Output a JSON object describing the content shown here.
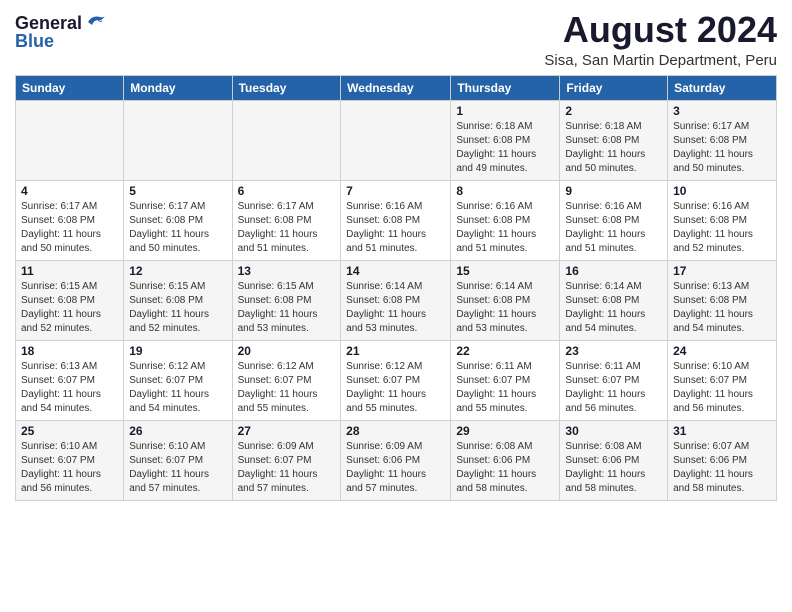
{
  "logo": {
    "general": "General",
    "blue": "Blue"
  },
  "header": {
    "month_year": "August 2024",
    "location": "Sisa, San Martin Department, Peru"
  },
  "weekdays": [
    "Sunday",
    "Monday",
    "Tuesday",
    "Wednesday",
    "Thursday",
    "Friday",
    "Saturday"
  ],
  "weeks": [
    [
      {
        "day": "",
        "info": ""
      },
      {
        "day": "",
        "info": ""
      },
      {
        "day": "",
        "info": ""
      },
      {
        "day": "",
        "info": ""
      },
      {
        "day": "1",
        "info": "Sunrise: 6:18 AM\nSunset: 6:08 PM\nDaylight: 11 hours\nand 49 minutes."
      },
      {
        "day": "2",
        "info": "Sunrise: 6:18 AM\nSunset: 6:08 PM\nDaylight: 11 hours\nand 50 minutes."
      },
      {
        "day": "3",
        "info": "Sunrise: 6:17 AM\nSunset: 6:08 PM\nDaylight: 11 hours\nand 50 minutes."
      }
    ],
    [
      {
        "day": "4",
        "info": "Sunrise: 6:17 AM\nSunset: 6:08 PM\nDaylight: 11 hours\nand 50 minutes."
      },
      {
        "day": "5",
        "info": "Sunrise: 6:17 AM\nSunset: 6:08 PM\nDaylight: 11 hours\nand 50 minutes."
      },
      {
        "day": "6",
        "info": "Sunrise: 6:17 AM\nSunset: 6:08 PM\nDaylight: 11 hours\nand 51 minutes."
      },
      {
        "day": "7",
        "info": "Sunrise: 6:16 AM\nSunset: 6:08 PM\nDaylight: 11 hours\nand 51 minutes."
      },
      {
        "day": "8",
        "info": "Sunrise: 6:16 AM\nSunset: 6:08 PM\nDaylight: 11 hours\nand 51 minutes."
      },
      {
        "day": "9",
        "info": "Sunrise: 6:16 AM\nSunset: 6:08 PM\nDaylight: 11 hours\nand 51 minutes."
      },
      {
        "day": "10",
        "info": "Sunrise: 6:16 AM\nSunset: 6:08 PM\nDaylight: 11 hours\nand 52 minutes."
      }
    ],
    [
      {
        "day": "11",
        "info": "Sunrise: 6:15 AM\nSunset: 6:08 PM\nDaylight: 11 hours\nand 52 minutes."
      },
      {
        "day": "12",
        "info": "Sunrise: 6:15 AM\nSunset: 6:08 PM\nDaylight: 11 hours\nand 52 minutes."
      },
      {
        "day": "13",
        "info": "Sunrise: 6:15 AM\nSunset: 6:08 PM\nDaylight: 11 hours\nand 53 minutes."
      },
      {
        "day": "14",
        "info": "Sunrise: 6:14 AM\nSunset: 6:08 PM\nDaylight: 11 hours\nand 53 minutes."
      },
      {
        "day": "15",
        "info": "Sunrise: 6:14 AM\nSunset: 6:08 PM\nDaylight: 11 hours\nand 53 minutes."
      },
      {
        "day": "16",
        "info": "Sunrise: 6:14 AM\nSunset: 6:08 PM\nDaylight: 11 hours\nand 54 minutes."
      },
      {
        "day": "17",
        "info": "Sunrise: 6:13 AM\nSunset: 6:08 PM\nDaylight: 11 hours\nand 54 minutes."
      }
    ],
    [
      {
        "day": "18",
        "info": "Sunrise: 6:13 AM\nSunset: 6:07 PM\nDaylight: 11 hours\nand 54 minutes."
      },
      {
        "day": "19",
        "info": "Sunrise: 6:12 AM\nSunset: 6:07 PM\nDaylight: 11 hours\nand 54 minutes."
      },
      {
        "day": "20",
        "info": "Sunrise: 6:12 AM\nSunset: 6:07 PM\nDaylight: 11 hours\nand 55 minutes."
      },
      {
        "day": "21",
        "info": "Sunrise: 6:12 AM\nSunset: 6:07 PM\nDaylight: 11 hours\nand 55 minutes."
      },
      {
        "day": "22",
        "info": "Sunrise: 6:11 AM\nSunset: 6:07 PM\nDaylight: 11 hours\nand 55 minutes."
      },
      {
        "day": "23",
        "info": "Sunrise: 6:11 AM\nSunset: 6:07 PM\nDaylight: 11 hours\nand 56 minutes."
      },
      {
        "day": "24",
        "info": "Sunrise: 6:10 AM\nSunset: 6:07 PM\nDaylight: 11 hours\nand 56 minutes."
      }
    ],
    [
      {
        "day": "25",
        "info": "Sunrise: 6:10 AM\nSunset: 6:07 PM\nDaylight: 11 hours\nand 56 minutes."
      },
      {
        "day": "26",
        "info": "Sunrise: 6:10 AM\nSunset: 6:07 PM\nDaylight: 11 hours\nand 57 minutes."
      },
      {
        "day": "27",
        "info": "Sunrise: 6:09 AM\nSunset: 6:07 PM\nDaylight: 11 hours\nand 57 minutes."
      },
      {
        "day": "28",
        "info": "Sunrise: 6:09 AM\nSunset: 6:06 PM\nDaylight: 11 hours\nand 57 minutes."
      },
      {
        "day": "29",
        "info": "Sunrise: 6:08 AM\nSunset: 6:06 PM\nDaylight: 11 hours\nand 58 minutes."
      },
      {
        "day": "30",
        "info": "Sunrise: 6:08 AM\nSunset: 6:06 PM\nDaylight: 11 hours\nand 58 minutes."
      },
      {
        "day": "31",
        "info": "Sunrise: 6:07 AM\nSunset: 6:06 PM\nDaylight: 11 hours\nand 58 minutes."
      }
    ]
  ]
}
